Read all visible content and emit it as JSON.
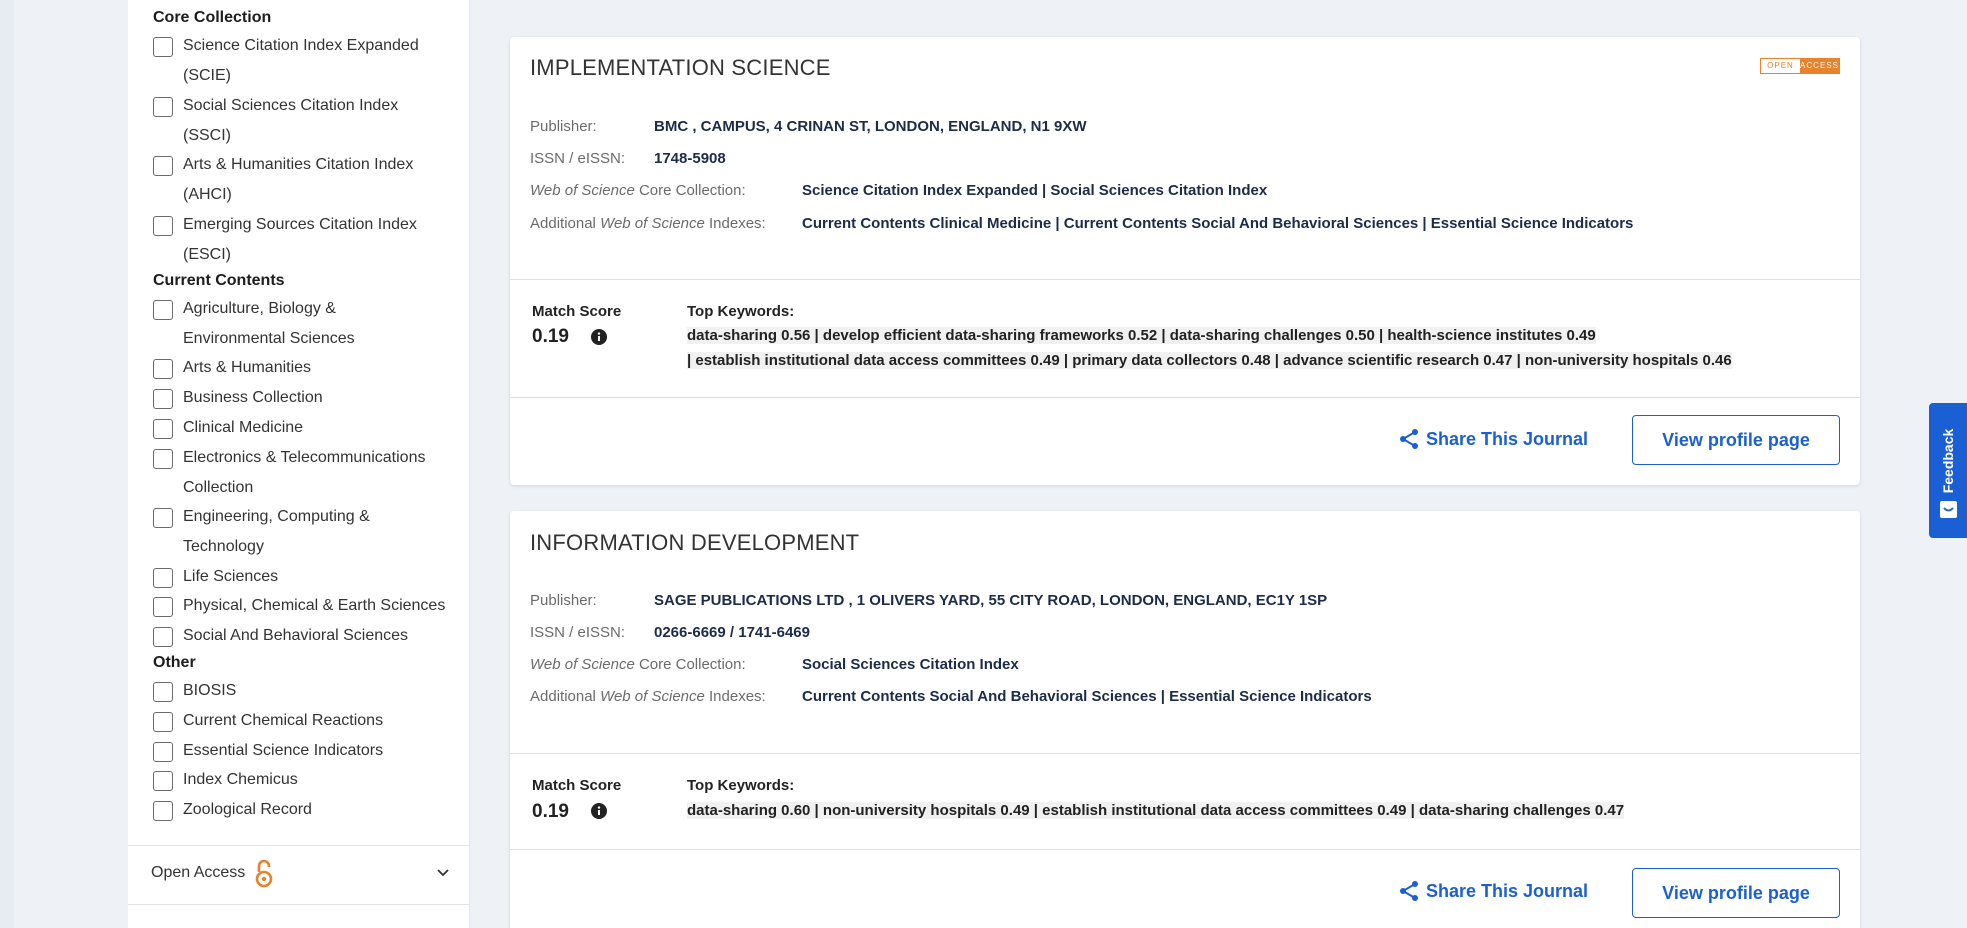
{
  "sidebar": {
    "groups": [
      {
        "title": "Core Collection",
        "items": [
          {
            "line1": "Science Citation Index Expanded",
            "line2": "(SCIE)"
          },
          {
            "line1": "Social Sciences Citation Index",
            "line2": "(SSCI)"
          },
          {
            "line1": "Arts & Humanities Citation Index",
            "line2": "(AHCI)"
          },
          {
            "line1": "Emerging Sources Citation Index",
            "line2": "(ESCI)"
          }
        ]
      },
      {
        "title": "Current Contents",
        "items": [
          {
            "line1": "Agriculture, Biology &",
            "line2": "Environmental Sciences"
          },
          {
            "line1": "Arts & Humanities"
          },
          {
            "line1": "Business Collection"
          },
          {
            "line1": "Clinical Medicine"
          },
          {
            "line1": "Electronics & Telecommunications",
            "line2": "Collection"
          },
          {
            "line1": "Engineering, Computing &",
            "line2": "Technology"
          },
          {
            "line1": "Life Sciences"
          },
          {
            "line1": "Physical, Chemical & Earth Sciences"
          },
          {
            "line1": "Social And Behavioral Sciences"
          }
        ]
      },
      {
        "title": "Other",
        "items": [
          {
            "line1": "BIOSIS"
          },
          {
            "line1": "Current Chemical Reactions"
          },
          {
            "line1": "Essential Science Indicators"
          },
          {
            "line1": "Index Chemicus"
          },
          {
            "line1": "Zoological Record"
          }
        ]
      }
    ],
    "open_access_label": "Open Access"
  },
  "journals": [
    {
      "title": "IMPLEMENTATION SCIENCE",
      "badge_left": "OPEN",
      "badge_right": "ACCESS",
      "publisher_label": "Publisher:",
      "publisher": "BMC , CAMPUS, 4 CRINAN ST, LONDON, ENGLAND, N1 9XW",
      "issn_label": "ISSN / eISSN:",
      "issn": "1748-5908",
      "core_label_italic": "Web of Science",
      "core_label_rest": " Core Collection:",
      "core": "Science Citation Index Expanded | Social Sciences Citation Index",
      "add_label_pre": "Additional ",
      "add_label_italic": "Web of Science",
      "add_label_rest": " Indexes:",
      "additional": "Current Contents Clinical Medicine | Current Contents Social And Behavioral Sciences | Essential Science Indicators",
      "match_score_label": "Match Score",
      "match_score": "0.19",
      "keywords_label": "Top Keywords:",
      "keywords_line1": "data-sharing 0.56 |  develop efficient data-sharing frameworks 0.52 |  data-sharing challenges 0.50 |  health-science institutes 0.49",
      "keywords_line2": " |  establish institutional data access committees 0.49 |  primary data collectors 0.48 |  advance scientific research 0.47 |  non-university hospitals 0.46",
      "share_label": "Share This Journal",
      "profile_label": "View profile page"
    },
    {
      "title": "INFORMATION DEVELOPMENT",
      "publisher_label": "Publisher:",
      "publisher": "SAGE PUBLICATIONS LTD , 1 OLIVERS YARD, 55 CITY ROAD, LONDON, ENGLAND, EC1Y 1SP",
      "issn_label": "ISSN / eISSN:",
      "issn": "0266-6669 / 1741-6469",
      "core_label_italic": "Web of Science",
      "core_label_rest": " Core Collection:",
      "core": "Social Sciences Citation Index",
      "add_label_pre": "Additional ",
      "add_label_italic": "Web of Science",
      "add_label_rest": " Indexes:",
      "additional": "Current Contents Social And Behavioral Sciences | Essential Science Indicators",
      "match_score_label": "Match Score",
      "match_score": "0.19",
      "keywords_label": "Top Keywords:",
      "keywords_line1": "data-sharing 0.60 |  non-university hospitals 0.49 |  establish institutional data access committees 0.49 |  data-sharing challenges 0.47",
      "share_label": "Share This Journal",
      "profile_label": "View profile page"
    }
  ],
  "feedback_label": "Feedback",
  "colors": {
    "accent": "#1a5fd4",
    "open_access": "#e8822b"
  }
}
